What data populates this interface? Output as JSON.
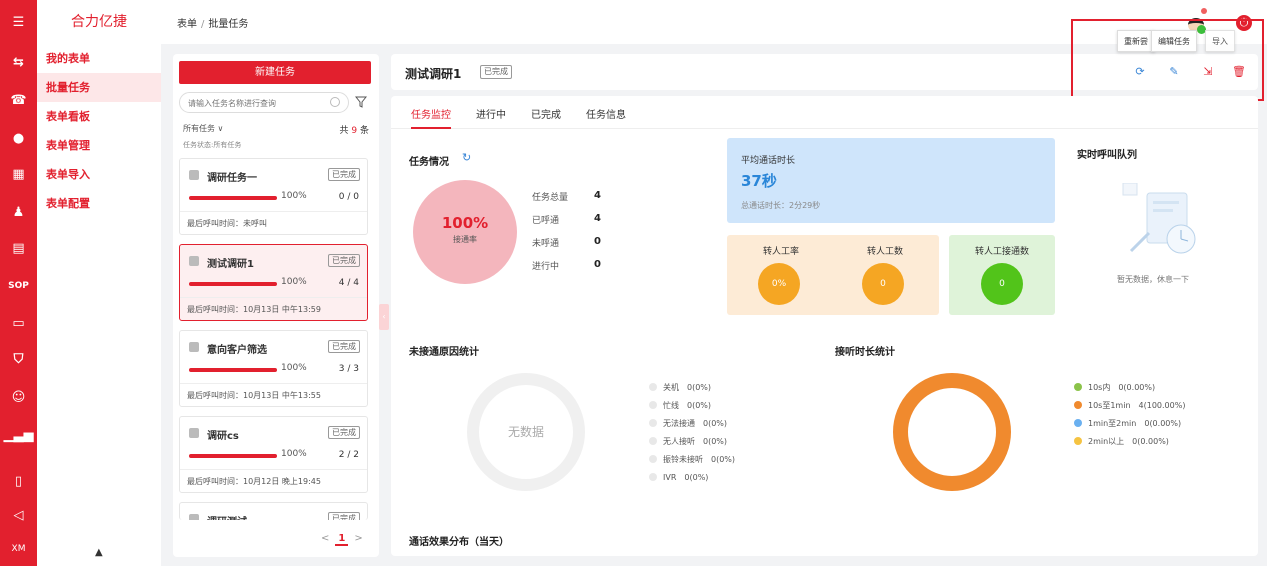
{
  "rail": {
    "icons": [
      "menu-icon",
      "shuffle-icon",
      "phone-icon",
      "chat-icon",
      "grid-icon",
      "person-icon",
      "clipboard-icon",
      "sop-label",
      "screen-icon",
      "shield-icon",
      "robot-icon",
      "bar-chart-icon",
      "book-icon",
      "megaphone-icon",
      "xm-label"
    ],
    "sop": "SOP",
    "xm": "XM"
  },
  "nav": {
    "brand": "合力亿捷",
    "items": [
      "我的表单",
      "批量任务",
      "表单看板",
      "表单管理",
      "表单导入",
      "表单配置"
    ],
    "active_index": 1
  },
  "breadcrumb": {
    "root": "表单",
    "sep": "/",
    "current": "批量任务"
  },
  "left": {
    "new_task": "新建任务",
    "search_placeholder": "请输入任务名称进行查询",
    "filter_label": "所有任务 ∨",
    "total_prefix": "共",
    "total": "9",
    "total_suffix": "条",
    "status_line": "任务状态:所有任务",
    "tasks": [
      {
        "name": "调研任务一",
        "tag": "已完成",
        "percent": "100%",
        "progress": 1.0,
        "count": "0 / 0",
        "last": "最后呼叫时间：未呼叫"
      },
      {
        "name": "测试调研1",
        "tag": "已完成",
        "percent": "100%",
        "progress": 1.0,
        "count": "4 / 4",
        "last": "最后呼叫时间：10月13日 中午13:59"
      },
      {
        "name": "意向客户筛选",
        "tag": "已完成",
        "percent": "100%",
        "progress": 1.0,
        "count": "3 / 3",
        "last": "最后呼叫时间：10月13日 中午13:55"
      },
      {
        "name": "调研cs",
        "tag": "已完成",
        "percent": "100%",
        "progress": 1.0,
        "count": "2 / 2",
        "last": "最后呼叫时间：10月12日 晚上19:45"
      },
      {
        "name": "调研测试",
        "tag": "已完成"
      }
    ],
    "pager": {
      "prev": "<",
      "page": "1",
      "next": ">"
    }
  },
  "header": {
    "title": "测试调研1",
    "tag": "已完成",
    "tooltips": [
      "重新尝",
      "编辑任务",
      "导入"
    ]
  },
  "tabs": [
    "任务监控",
    "进行中",
    "已完成",
    "任务信息"
  ],
  "overview": {
    "title": "任务情况",
    "rate": "100%",
    "rate_label": "接通率",
    "stats": [
      {
        "label": "任务总量",
        "value": "4"
      },
      {
        "label": "已呼通",
        "value": "4"
      },
      {
        "label": "未呼通",
        "value": "0"
      },
      {
        "label": "进行中",
        "value": "0"
      }
    ]
  },
  "avg": {
    "label": "平均通话时长",
    "value": "37秒",
    "total": "总通话时长：2分29秒"
  },
  "transfer": [
    {
      "label": "转人工率",
      "value": "0%",
      "bg": "#fdebd6",
      "ball": "#f5a623"
    },
    {
      "label": "转人工数",
      "value": "0",
      "bg": "#fdebd6",
      "ball": "#f5a623"
    },
    {
      "label": "转人工接通数",
      "value": "0",
      "bg": "#dff3d9",
      "ball": "#52c41a"
    }
  ],
  "queue": {
    "title": "实时呼叫队列",
    "empty": "暂无数据，休息一下"
  },
  "unanswered": {
    "title": "未接通原因统计",
    "empty": "无数据",
    "legend": [
      "关机　0(0%)",
      "忙线　0(0%)",
      "无法接通　0(0%)",
      "无人接听　0(0%)",
      "振铃未接听　0(0%)",
      "IVR　0(0%)"
    ]
  },
  "duration": {
    "title": "接听时长统计",
    "legend": [
      {
        "text": "10s内　0(0.00%)",
        "color": "#8bc34a"
      },
      {
        "text": "10s至1min　4(100.00%)",
        "color": "#f08a2e"
      },
      {
        "text": "1min至2min　0(0.00%)",
        "color": "#6ab0f0"
      },
      {
        "text": "2min以上　0(0.00%)",
        "color": "#f5c342"
      }
    ]
  },
  "bottom_title": "通话效果分布（当天）"
}
